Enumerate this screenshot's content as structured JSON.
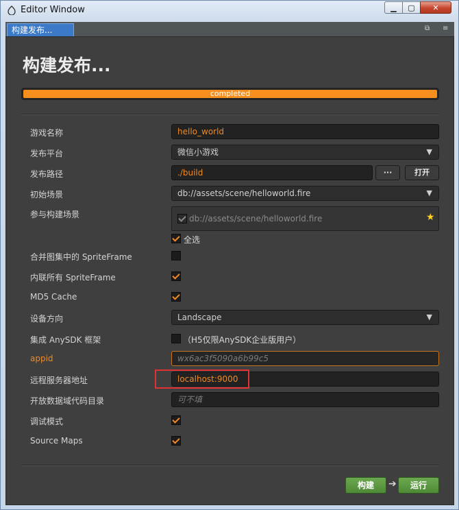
{
  "window": {
    "title": "Editor Window",
    "min_glyph": "▁",
    "max_glyph": "▢",
    "close_glyph": "✕"
  },
  "tab": {
    "label": "构建发布...",
    "restore_glyph": "⧉",
    "menu_glyph": "≡"
  },
  "page": {
    "title": "构建发布..."
  },
  "progress": {
    "value": 1.0,
    "label": "completed"
  },
  "form": {
    "game_name": {
      "label": "游戏名称",
      "value": "hello_world"
    },
    "platform": {
      "label": "发布平台",
      "value": "微信小游戏"
    },
    "build_path": {
      "label": "发布路径",
      "value": "./build",
      "browse_label": "···",
      "open_label": "打开"
    },
    "start_scene": {
      "label": "初始场景",
      "value": "db://assets/scene/helloworld.fire"
    },
    "build_scenes": {
      "label": "参与构建场景",
      "item": "db://assets/scene/helloworld.fire",
      "select_all": "全选"
    },
    "merge_sprite": {
      "label": "合并图集中的 SpriteFrame",
      "checked": false
    },
    "inline_sprite": {
      "label": "内联所有 SpriteFrame",
      "checked": true
    },
    "md5": {
      "label": "MD5 Cache",
      "checked": true
    },
    "orientation": {
      "label": "设备方向",
      "value": "Landscape"
    },
    "anysdk": {
      "label": "集成 AnySDK 框架",
      "note": "（H5仅限AnySDK企业版用户）",
      "checked": false
    },
    "appid": {
      "label": "appid",
      "placeholder": "wx6ac3f5090a6b99c5"
    },
    "remote": {
      "label": "远程服务器地址",
      "value": "localhost:9000"
    },
    "open_data": {
      "label": "开放数据域代码目录",
      "placeholder": "可不填"
    },
    "debug": {
      "label": "调试模式",
      "checked": true
    },
    "source_maps": {
      "label": "Source Maps",
      "checked": true
    }
  },
  "actions": {
    "build": "构建",
    "run": "运行",
    "arrow": "➔"
  },
  "colors": {
    "accent": "#f08a24",
    "progress": "#f78f1e",
    "button_green": "#5a9a40",
    "panel": "#3f3f3f"
  }
}
